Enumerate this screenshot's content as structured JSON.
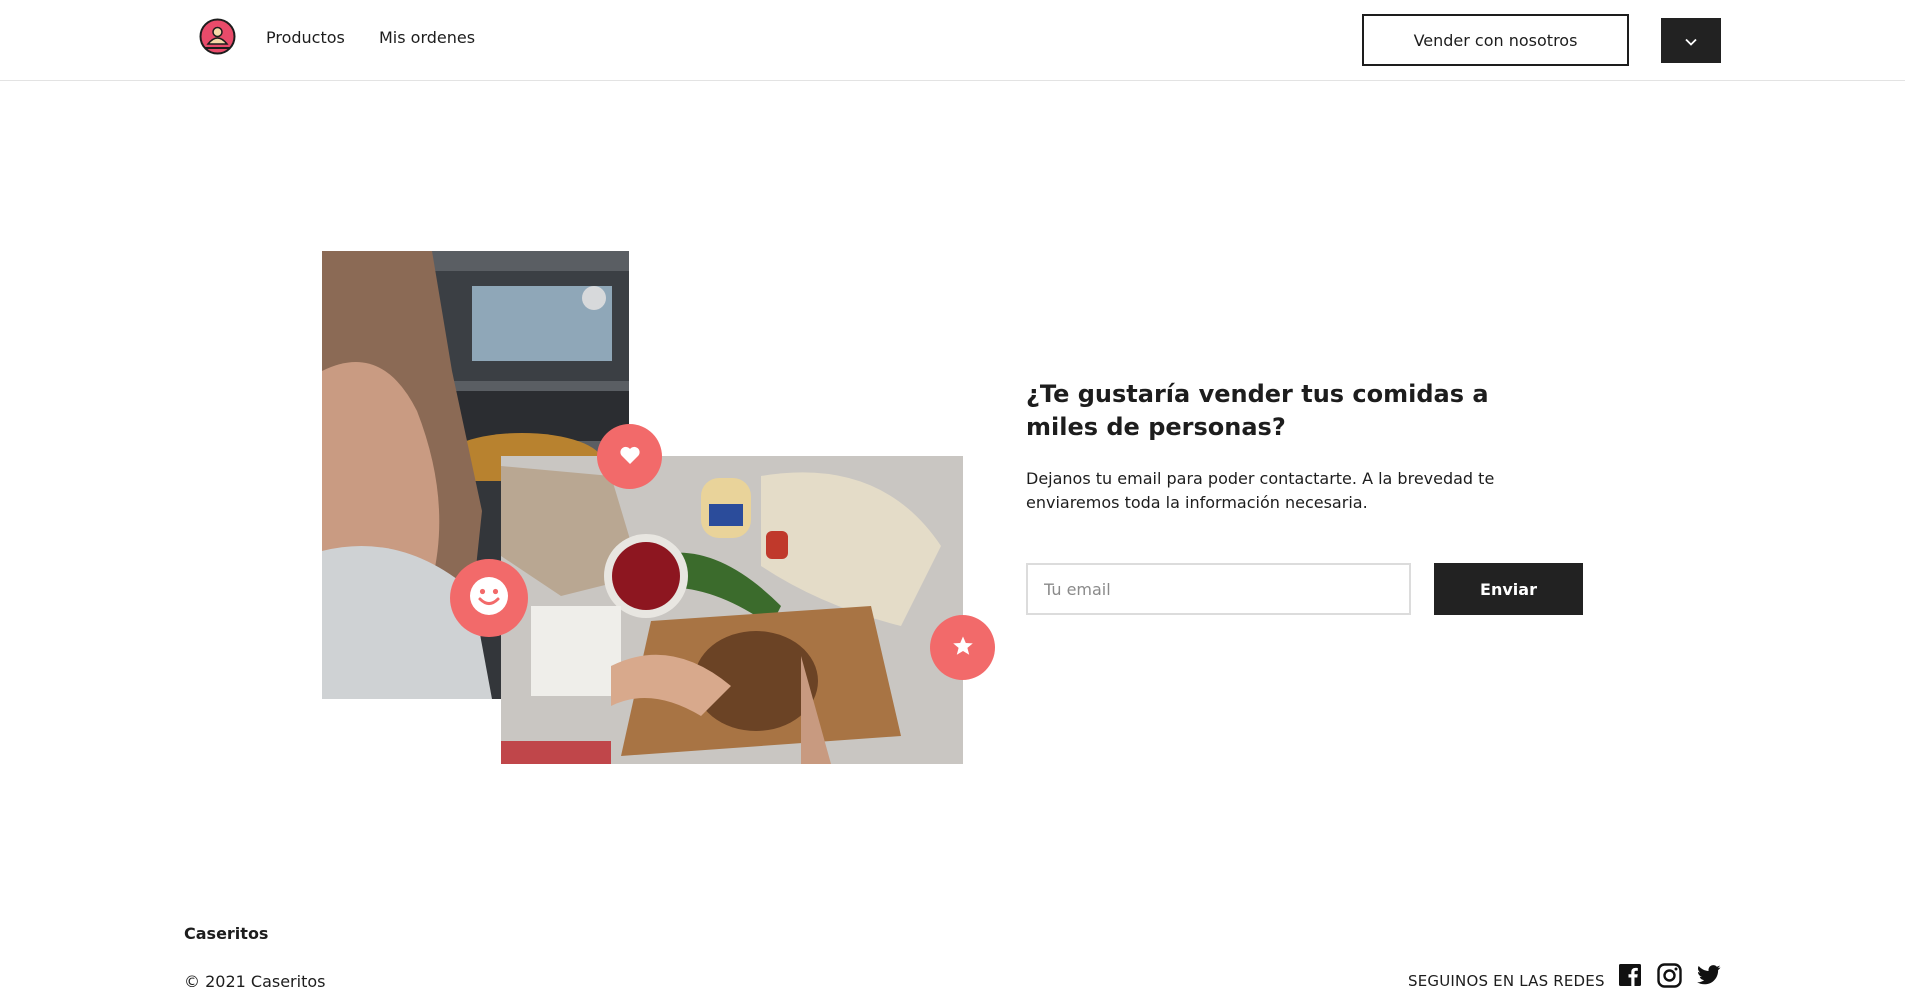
{
  "header": {
    "logo_icon": "caseritos-logo-icon",
    "nav": [
      {
        "label": "Productos"
      },
      {
        "label": "Mis ordenes"
      }
    ],
    "sell_button_label": "Vender con nosotros",
    "menu_icon": "chevron-down-icon"
  },
  "hero": {
    "headline": "¿Te gustaría vender tus comidas a miles de personas?",
    "description": "Dejanos tu email para poder contactarte. A la brevedad te enviaremos toda la información necesaria.",
    "email_placeholder": "Tu email",
    "email_value": "",
    "submit_label": "Enviar",
    "badges": [
      "heart-icon",
      "smile-icon",
      "star-icon"
    ]
  },
  "footer": {
    "brand": "Caseritos",
    "copyright": "© 2021 Caseritos",
    "social_label": "SEGUINOS EN LAS REDES",
    "social_icons": [
      "facebook-icon",
      "instagram-icon",
      "twitter-icon"
    ]
  },
  "colors": {
    "accent": "#f26a6a",
    "dark": "#222222",
    "text": "#1d1d1d"
  }
}
